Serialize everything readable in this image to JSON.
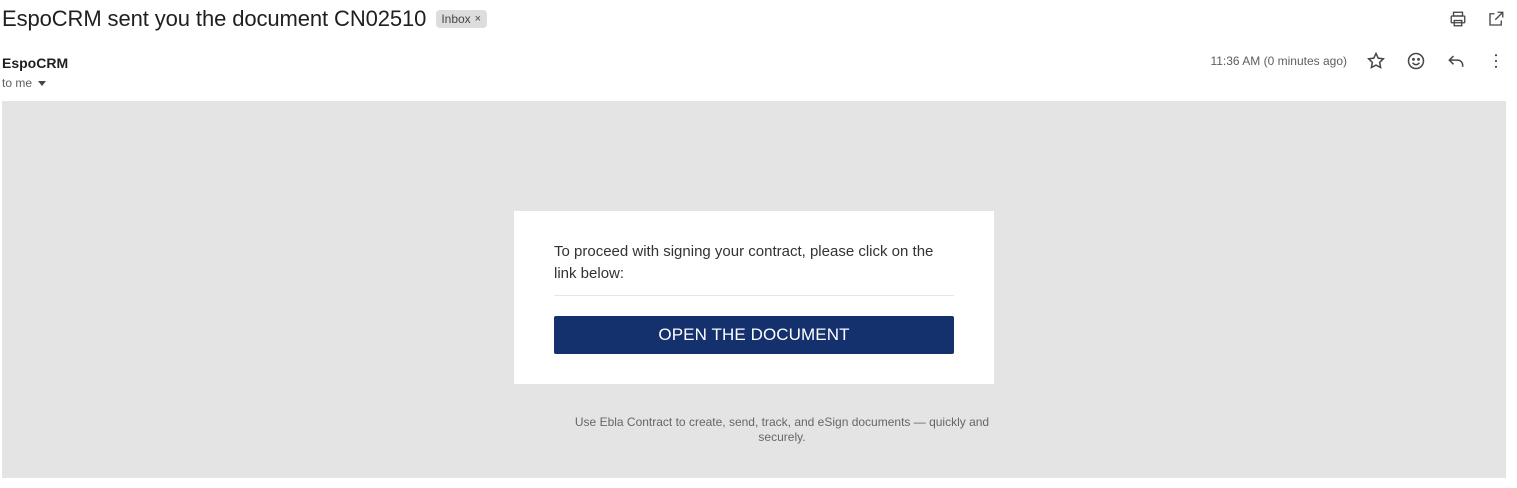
{
  "email": {
    "subject": "EspoCRM sent you the document CN02510",
    "label": "Inbox",
    "label_remove": "×",
    "sender": "EspoCRM",
    "recipient": "to me",
    "timestamp": "11:36 AM (0 minutes ago)"
  },
  "toolbar": {
    "icons": [
      "print-icon",
      "open-in-new-window-icon"
    ]
  },
  "message_actions": {
    "icons": [
      "star-icon",
      "emoji-reaction-icon",
      "reply-icon",
      "more-vert-icon"
    ]
  },
  "body": {
    "instruction": "To proceed with signing your contract, please click on the link below:",
    "button_label": "OPEN THE DOCUMENT",
    "footer": "Use Ebla Contract to create, send, track, and eSign documents — quickly and securely."
  },
  "colors": {
    "button_bg": "#14306d",
    "body_bg": "#e4e4e4",
    "chip_bg": "#dddddd"
  }
}
